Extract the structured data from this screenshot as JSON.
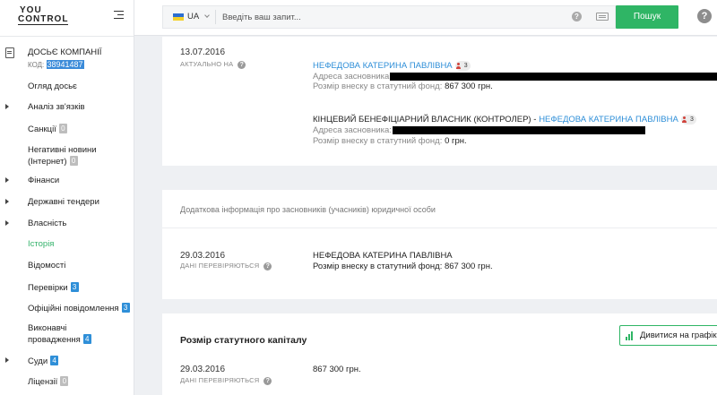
{
  "logo": {
    "line1": "YOU",
    "line2": "CONTROL"
  },
  "sidebar": {
    "dossier_title": "ДОСЬЄ КОМПАНІЇ",
    "code_label": "КОД:",
    "code_value": "38941487",
    "items": [
      {
        "label": "Огляд досьє",
        "arrow": false
      },
      {
        "label": "Аналіз зв'язків",
        "arrow": true
      },
      {
        "label": "Санкції",
        "arrow": false,
        "badge": "0",
        "badge_color": "grey"
      },
      {
        "label": "Негативні новини",
        "label2": "(Інтернет)",
        "arrow": false,
        "badge": "0",
        "badge_color": "grey"
      },
      {
        "label": "Фінанси",
        "arrow": true
      },
      {
        "label": "Державні тендери",
        "arrow": true
      },
      {
        "label": "Власність",
        "arrow": true
      },
      {
        "label": "Історія",
        "arrow": false,
        "active": true
      },
      {
        "label": "Відомості",
        "arrow": false
      },
      {
        "label": "Перевірки",
        "arrow": false,
        "badge": "3",
        "badge_color": "blue"
      },
      {
        "label": "Офіційні повідомлення",
        "arrow": false,
        "badge": "3",
        "badge_color": "blue"
      },
      {
        "label": "Виконавчі",
        "label2": "провадження",
        "arrow": false,
        "badge": "4",
        "badge_color": "blue"
      },
      {
        "label": "Суди",
        "arrow": true,
        "badge": "4",
        "badge_color": "blue"
      },
      {
        "label": "Ліцензії",
        "arrow": false,
        "badge": "0",
        "badge_color": "grey"
      }
    ]
  },
  "topbar": {
    "country": "UA",
    "search_placeholder": "Введіть ваш запит...",
    "help_small": "?",
    "search_button": "Пошук",
    "help_big": "?",
    "colors": {
      "accent": "#2fb565",
      "link": "#2f8fd8"
    }
  },
  "card1": {
    "date": "13.07.2016",
    "status": "АКТУАЛЬНО НА",
    "founder_name": "НЕФЕДОВА КАТЕРИНА ПАВЛІВНА",
    "founder_badge": "3",
    "address_label": "Адреса засновника:",
    "contribution_label": "Розмір внеску в статутний фонд:",
    "contribution_value_1": "867 300 грн.",
    "beneficiary_prefix": "КІНЦЕВИЙ БЕНЕФІЦІАРНИЙ ВЛАСНИК (КОНТРОЛЕР) -",
    "beneficiary_name": "НЕФЕДОВА КАТЕРИНА ПАВЛІВНА",
    "beneficiary_badge": "3",
    "contribution_value_2": "0 грн."
  },
  "card2": {
    "note": "Додаткова інформація про засновників (учасників) юридичної особи",
    "date": "29.03.2016",
    "status": "ДАНІ ПЕРЕВІРЯЮТЬСЯ",
    "name": "НЕФЕДОВА КАТЕРИНА ПАВЛІВНА",
    "contribution_label": "Розмір внеску в статутний фонд:",
    "contribution_value": "867 300 грн."
  },
  "card3": {
    "title": "Розмір статутного капіталу",
    "chart_button": "Дивитися на графіку",
    "date": "29.03.2016",
    "status": "ДАНІ ПЕРЕВІРЯЮТЬСЯ",
    "value": "867 300 грн."
  }
}
